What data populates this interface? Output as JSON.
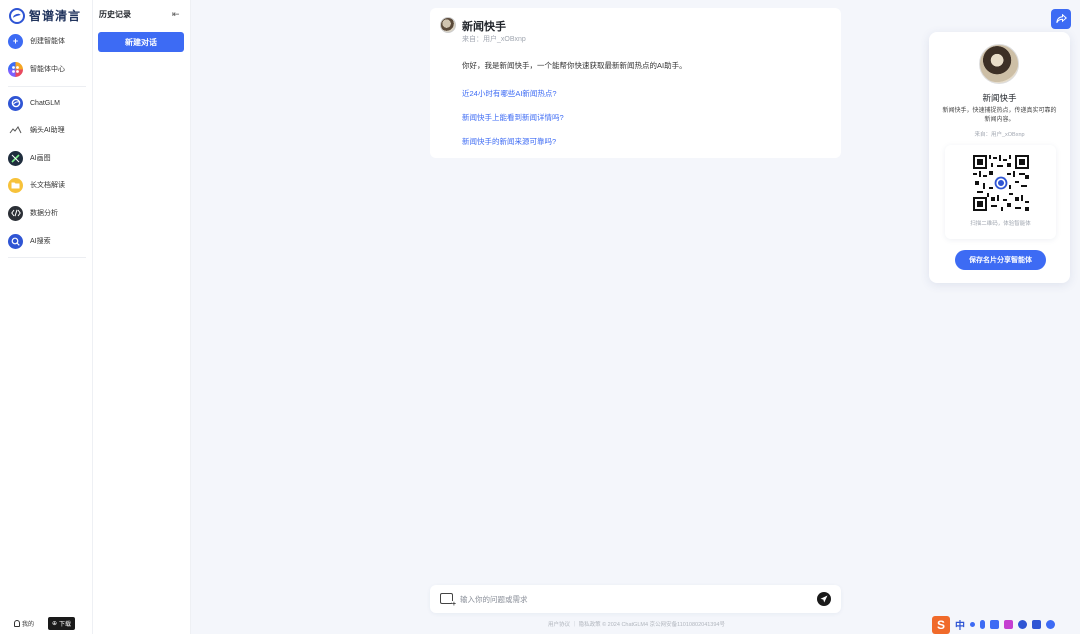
{
  "logo": {
    "text": "智谱清言"
  },
  "nav": {
    "items": [
      {
        "label": "创建智能体",
        "icon": "plus-icon"
      },
      {
        "label": "智能体中心",
        "icon": "apps-icon"
      },
      {
        "label": "ChatGLM",
        "icon": "chatglm-icon"
      },
      {
        "label": "蜗头AI助理",
        "icon": "assistant-icon"
      },
      {
        "label": "AI画图",
        "icon": "draw-icon"
      },
      {
        "label": "长文档解读",
        "icon": "folder-icon"
      },
      {
        "label": "数据分析",
        "icon": "code-icon"
      },
      {
        "label": "AI搜索",
        "icon": "search-icon"
      }
    ],
    "mine": "我的",
    "download": "下载"
  },
  "history": {
    "title": "历史记录",
    "new_chat": "新建对话"
  },
  "chat": {
    "agent_name": "新闻快手",
    "source": "来自：用户_xOBxnp",
    "intro": "你好，我是新闻快手，一个能帮你快速获取最新新闻热点的AI助手。",
    "suggestions": [
      "近24小时有哪些AI新闻热点?",
      "新闻快手上能看到新闻详情吗?",
      "新闻快手的新闻来源可靠吗?"
    ]
  },
  "profile": {
    "name": "新闻快手",
    "description": "新闻快手，快速捕捉热点，传递真实可靠的新闻内容。",
    "source": "来自：用户_xOBxnp",
    "qr_caption": "扫描二维码，体验智能体",
    "save_button": "保存名片分享智能体"
  },
  "input": {
    "placeholder": "输入你的问题或需求"
  },
  "footer": {
    "text": "用户协议 ｜ 隐私政策 © 2024 ChatGLM4 京公网安备11010802041394号"
  },
  "ime": {
    "logo": "S",
    "lang": "中"
  },
  "colors": {
    "accent": "#3d6bf4",
    "background": "#f4f6fb"
  }
}
